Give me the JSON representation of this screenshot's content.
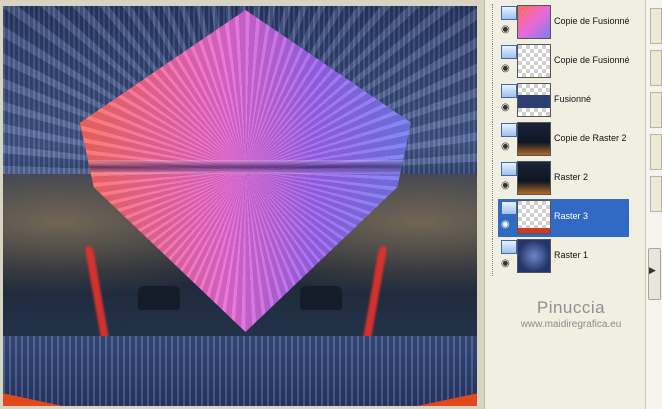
{
  "layers": [
    {
      "name": "Copie de Fusionné",
      "thumb": "diamond",
      "selected": false
    },
    {
      "name": "Copie de Fusionné",
      "thumb": "transparent",
      "selected": false
    },
    {
      "name": "Fusionné",
      "thumb": "band",
      "selected": false
    },
    {
      "name": "Copie de Raster 2",
      "thumb": "photo",
      "selected": false
    },
    {
      "name": "Raster 2",
      "thumb": "photo",
      "selected": false
    },
    {
      "name": "Raster 3",
      "thumb": "redline",
      "selected": true
    },
    {
      "name": "Raster 1",
      "thumb": "blue",
      "selected": false
    }
  ],
  "icons": {
    "layer_type": "raster-layer-icon",
    "visibility": "eye-icon"
  },
  "watermark": {
    "line1": "Pinuccia",
    "line2": "www.maidiregrafica.eu"
  },
  "colors": {
    "selection": "#316ac5",
    "panel_bg": "#f1efe2",
    "accent_red": "#e2471d"
  }
}
